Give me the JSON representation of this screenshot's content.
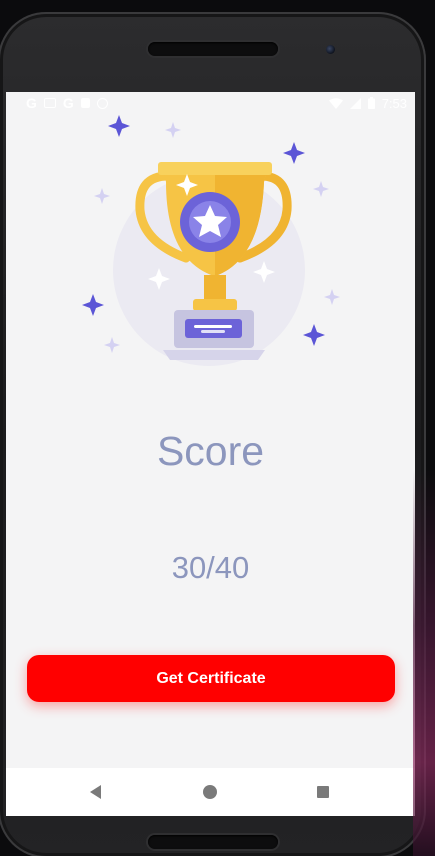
{
  "status_bar": {
    "left_icons": [
      "G",
      "image-icon",
      "G",
      "lock-icon",
      "sync-icon"
    ],
    "time": "7:53"
  },
  "score": {
    "title": "Score",
    "value": "30/40"
  },
  "actions": {
    "certificate_label": "Get Certificate"
  },
  "colors": {
    "screen_background": "#f4f4f5",
    "score_text": "#8c96bd",
    "button_background": "#ff0000",
    "button_text": "#ffffff",
    "trophy_gold": "#f6c445",
    "trophy_badge": "#6c63d8",
    "sparkle": "#5b55d6"
  },
  "nav_bar": {
    "buttons": [
      "back-icon",
      "home-icon",
      "recents-icon"
    ]
  }
}
